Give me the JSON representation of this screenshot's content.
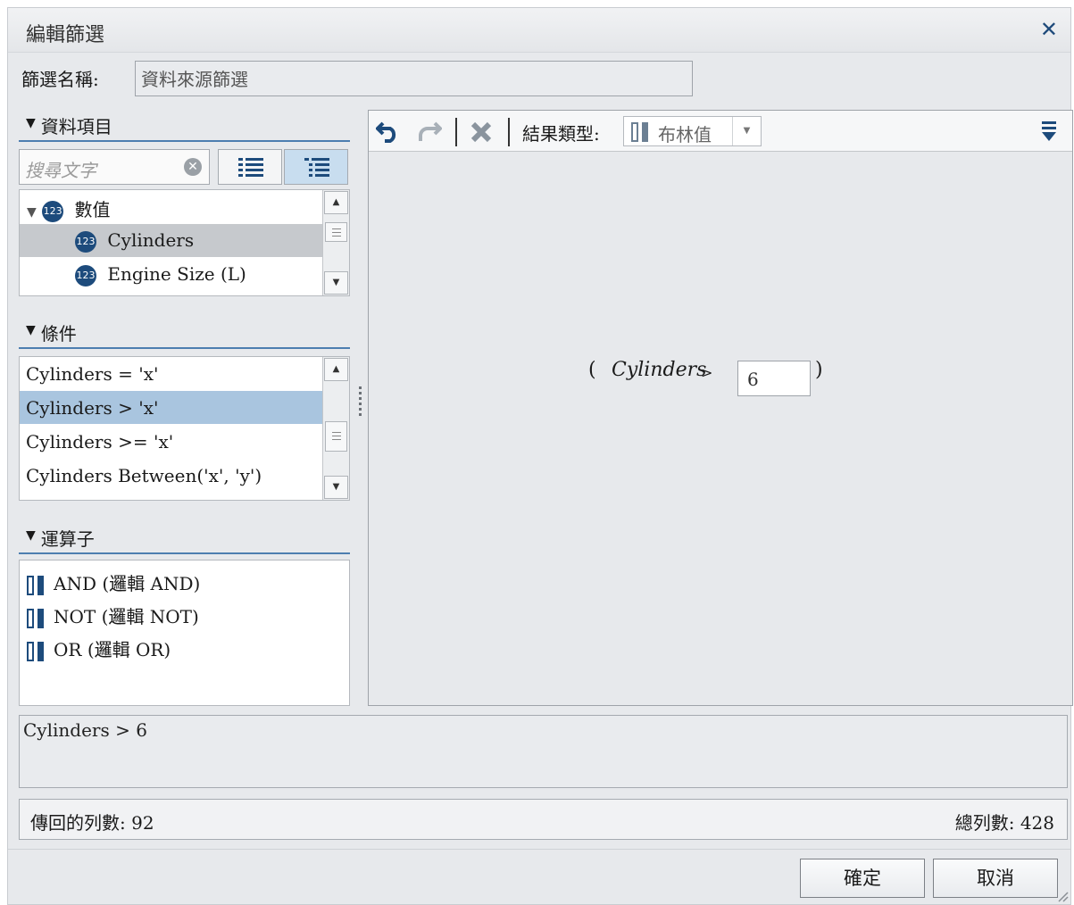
{
  "dialog": {
    "title": "編輯篩選",
    "close_symbol": "✕",
    "filter_name_label": "篩選名稱:",
    "filter_name_value": "資料來源篩選"
  },
  "data_items": {
    "header": "資料項目",
    "search_placeholder": "搜尋文字",
    "tree": [
      {
        "label": "數值",
        "icon": "numeric-123-icon",
        "level": 0
      },
      {
        "label": "Cylinders",
        "icon": "numeric-123-icon",
        "level": 1,
        "selected": true
      },
      {
        "label": "Engine Size (L)",
        "icon": "numeric-123-icon",
        "level": 1
      }
    ]
  },
  "conditions": {
    "header": "條件",
    "items": [
      "Cylinders = 'x'",
      "Cylinders > 'x'",
      "Cylinders >= 'x'",
      "Cylinders Between('x', 'y')"
    ],
    "selected_index": 1
  },
  "operators": {
    "header": "運算子",
    "items": [
      "AND (邏輯 AND)",
      "NOT (邏輯 NOT)",
      "OR (邏輯 OR)"
    ]
  },
  "toolbar": {
    "result_type_label": "結果類型:",
    "result_type_value": "布林值"
  },
  "expression": {
    "open_paren": "(",
    "field": "Cylinders",
    "operator": ">",
    "value": "6",
    "close_paren": ")"
  },
  "text_expression": "Cylinders > 6",
  "status": {
    "returned_rows": "傳回的列數: 92",
    "total_rows": "總列數: 428"
  },
  "buttons": {
    "ok": "確定",
    "cancel": "取消"
  },
  "colors": {
    "accent_blue": "#1d4b7c",
    "selection_blue": "#a9c5df",
    "selection_gray": "#c6c9cd"
  }
}
